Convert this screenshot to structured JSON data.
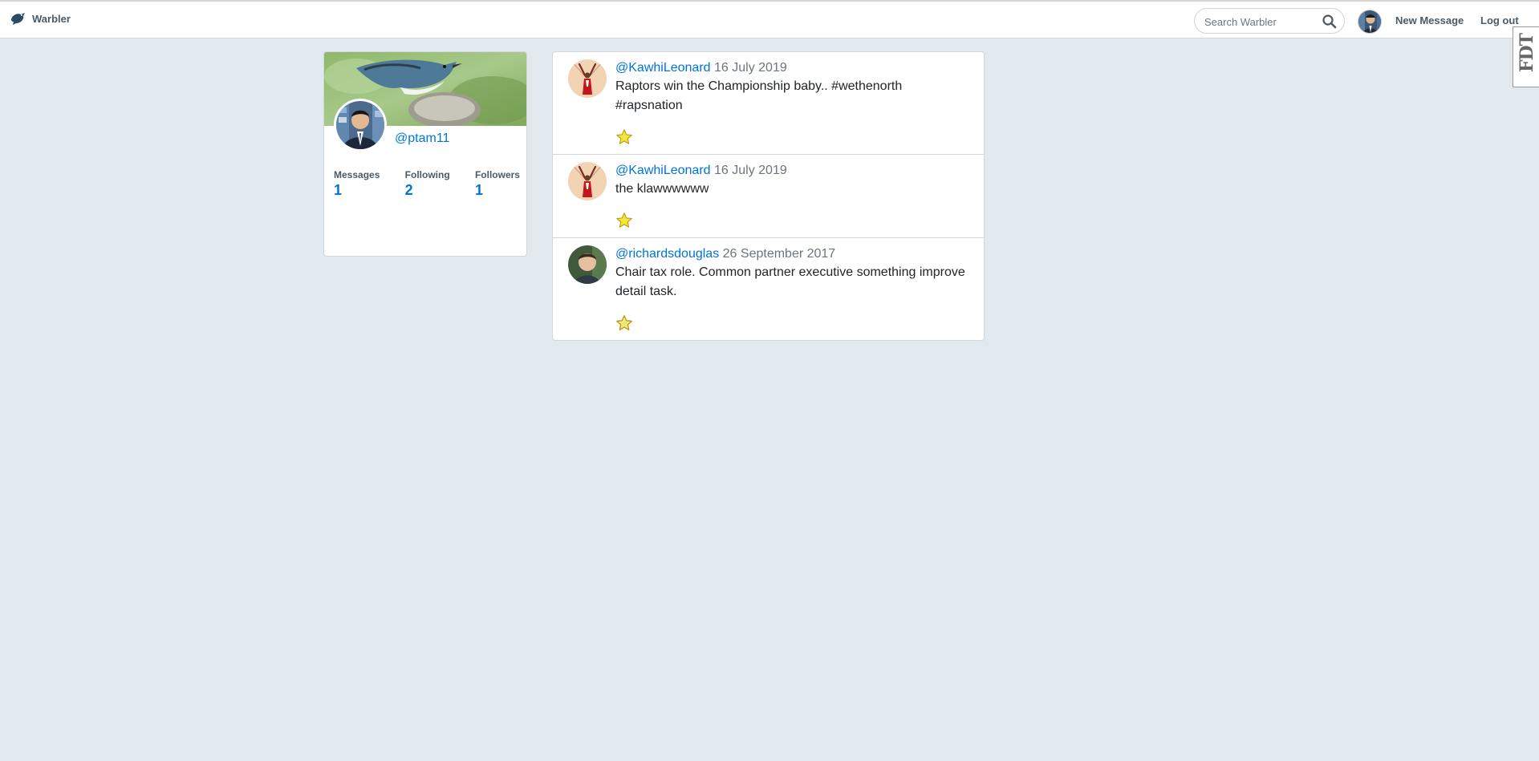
{
  "brand": {
    "name": "Warbler"
  },
  "search": {
    "placeholder": "Search Warbler"
  },
  "nav": {
    "new_message": "New Message",
    "logout": "Log out"
  },
  "fdt": {
    "label": "FDT"
  },
  "profile": {
    "handle": "@ptam11",
    "stats": [
      {
        "label": "Messages",
        "value": "1"
      },
      {
        "label": "Following",
        "value": "2"
      },
      {
        "label": "Followers",
        "value": "1"
      }
    ]
  },
  "messages": [
    {
      "user": "@KawhiLeonard",
      "date": "16 July 2019",
      "text": "Raptors win the Championship baby.. #wethenorth #rapsnation",
      "liked": true
    },
    {
      "user": "@KawhiLeonard",
      "date": "16 July 2019",
      "text": "the klawwwwww",
      "liked": true
    },
    {
      "user": "@richardsdouglas",
      "date": "26 September 2017",
      "text": "Chair tax role. Common partner executive something improve detail task.",
      "liked": false
    }
  ],
  "colors": {
    "link": "#0074d9",
    "background": "#e1e9ee",
    "star": "#f5e63a"
  }
}
